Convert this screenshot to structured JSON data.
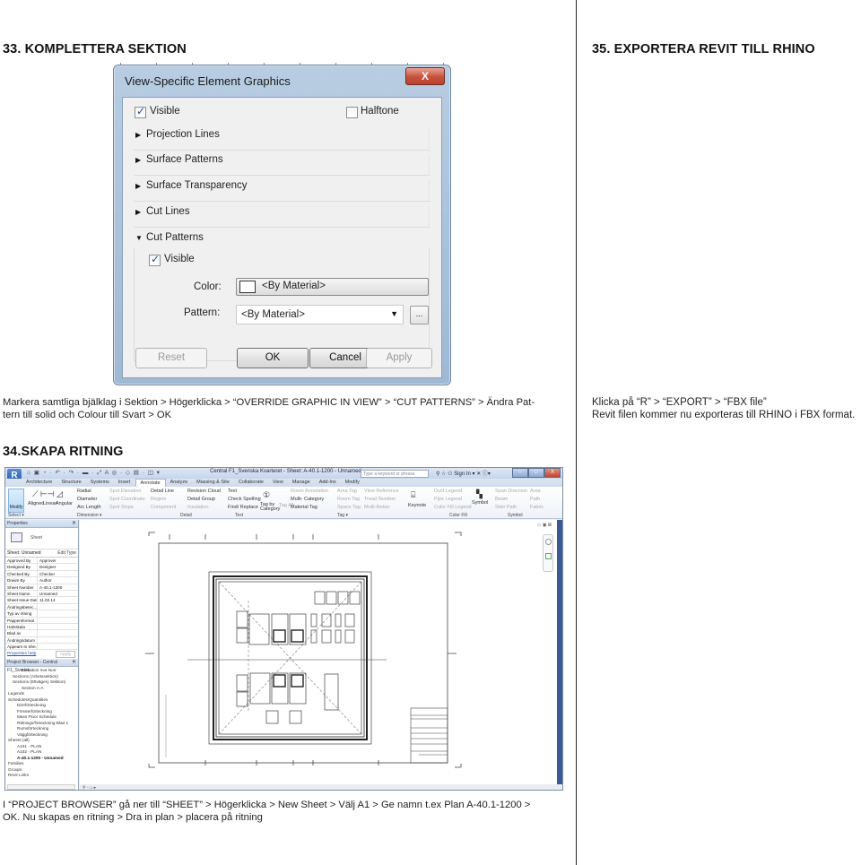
{
  "sections": {
    "s33": {
      "title": "33. KOMPLETTERA SEKTION",
      "caption_line1": "Markera samtliga bjälklag i Sektion > Högerklicka > “OVERRIDE GRAPHIC IN VIEW” > “CUT PATTERNS” > Ändra Pat-",
      "caption_line2": "tern till solid och Colour till Svart > OK"
    },
    "s34": {
      "title": "34.SKAPA RITNING",
      "caption_line1": "I “PROJECT BROWSER” gå ner till “SHEET” > Högerklicka > New Sheet > Välj A1 > Ge namn t.ex Plan A-40.1-1200 >",
      "caption_line2": "OK. Nu skapas en ritning > Dra in plan > placera på ritning"
    },
    "s35": {
      "title": "35. EXPORTERA REVIT TILL RHINO",
      "caption_line1": "Klicka på “R” > “EXPORT” > “FBX file”",
      "caption_line2": "Revit filen kommer nu exporteras till RHINO i FBX format."
    }
  },
  "dialog": {
    "title": "View-Specific Element Graphics",
    "close_glyph": "X",
    "visible_label": "Visible",
    "visible_checked": true,
    "halftone_label": "Halftone",
    "halftone_checked": false,
    "groups": [
      {
        "label": "Projection Lines",
        "expanded": false
      },
      {
        "label": "Surface Patterns",
        "expanded": false
      },
      {
        "label": "Surface Transparency",
        "expanded": false
      },
      {
        "label": "Cut Lines",
        "expanded": false
      },
      {
        "label": "Cut Patterns",
        "expanded": true
      }
    ],
    "cut_patterns": {
      "visible_label": "Visible",
      "visible_checked": true,
      "color_label": "Color:",
      "color_value": "<By Material>",
      "pattern_label": "Pattern:",
      "pattern_value": "<By Material>",
      "ellipsis": "..."
    },
    "buttons": {
      "reset": "Reset",
      "ok": "OK",
      "cancel": "Cancel",
      "apply": "Apply"
    }
  },
  "revit": {
    "app_button": "R",
    "doc_title": "Central F1_Svenska Kvarteret - Sheet: A-40.1-1200 - Unnamed",
    "search_placeholder": "Type a keyword or phrase",
    "sign_in": "Sign In",
    "win_buttons": [
      "–",
      "□",
      "X"
    ],
    "tabs": [
      "Architecture",
      "Structure",
      "Systems",
      "Insert",
      "Annotate",
      "Analyze",
      "Massing & Site",
      "Collaborate",
      "View",
      "Manage",
      "Add-Ins",
      "Modify"
    ],
    "active_tab": "Annotate",
    "ribbon": {
      "modify": "Modify",
      "dimension_tools": [
        "Aligned",
        "Linear",
        "Angular"
      ],
      "dimension_small": [
        "Radial",
        "Diameter",
        "Arc Length"
      ],
      "spot_tools": [
        "Spot Elevation",
        "Spot Coordinate",
        "Spot Slope"
      ],
      "detail_tools": [
        "Detail Line",
        "Region",
        "Component"
      ],
      "detail_tools2": [
        "Revision Cloud",
        "Detail Group",
        "Insulation"
      ],
      "text_tools": [
        "Text",
        "Check Spelling",
        "Find/ Replace"
      ],
      "tag_tools": [
        "Tag by Category",
        "Tag All"
      ],
      "tag_tools2": [
        "Room Annotation",
        "Multi- Category",
        "Material Tag"
      ],
      "tag_tools3": [
        "Area Tag",
        "Room Tag",
        "Space Tag"
      ],
      "tag_tools4": [
        "View Reference",
        "Tread Number",
        "Multi-Rebar"
      ],
      "keynote": "Keynote",
      "colorfill_tools": [
        "Duct Legend",
        "Pipe Legend",
        "Color Fill Legend"
      ],
      "symbol": "Symbol",
      "symbol_tools": [
        "Span Direction",
        "Beam",
        "Stair Path"
      ],
      "symbol_tools2": [
        "Area",
        "Path",
        "Fabric"
      ],
      "panels": [
        "Select ▾",
        "Dimension ▾",
        "Detail",
        "Text",
        "Tag ▾",
        "Color Fill",
        "Symbol"
      ]
    },
    "properties": {
      "title": "Properties",
      "type_name": "Sheet",
      "instance": "Sheet: Unnamed",
      "edit_type": "Edit Type",
      "rows": [
        {
          "k": "Approved By",
          "v": "Approver"
        },
        {
          "k": "Designed By",
          "v": "Designer"
        },
        {
          "k": "Checked By",
          "v": "Checker"
        },
        {
          "k": "Drawn By",
          "v": "Author"
        },
        {
          "k": "Sheet Number",
          "v": "A-40.1-1200"
        },
        {
          "k": "Sheet Name",
          "v": "Unnamed"
        },
        {
          "k": "Sheet Issue Date",
          "v": "11.02.14"
        },
        {
          "k": "Ändringsbetec...",
          "v": ""
        },
        {
          "k": "Typ av ritning",
          "v": ""
        },
        {
          "k": "Pappersformat",
          "v": ""
        },
        {
          "k": "Halvskala",
          "v": ""
        },
        {
          "k": "Blad av",
          "v": ""
        },
        {
          "k": "Ändringsdatum",
          "v": ""
        },
        {
          "k": "Appears In She...",
          "v": ""
        }
      ],
      "help": "Properties help",
      "apply": "Apply"
    },
    "project_browser": {
      "title": "Project Browser - Central F1_Svensk...",
      "items": [
        {
          "label": "Elevation mot Norr",
          "indent": 3,
          "bold": false
        },
        {
          "label": "Sections (Arbetssektion)",
          "indent": 1,
          "bold": false
        },
        {
          "label": "Sections (Ettvägery Sektion)",
          "indent": 1,
          "bold": false
        },
        {
          "label": "Section A-A",
          "indent": 3,
          "bold": false
        },
        {
          "label": "Legends",
          "indent": 0,
          "bold": false
        },
        {
          "label": "Schedules/Quantities",
          "indent": 0,
          "bold": false
        },
        {
          "label": "Dörrförteckning",
          "indent": 2,
          "bold": false
        },
        {
          "label": "Fönsterförteckning",
          "indent": 2,
          "bold": false
        },
        {
          "label": "Mass Floor Schedule",
          "indent": 2,
          "bold": false
        },
        {
          "label": "Rälnings/förteckning Blad 1",
          "indent": 2,
          "bold": false
        },
        {
          "label": "Rumsförteckning",
          "indent": 2,
          "bold": false
        },
        {
          "label": "Väggförteckning",
          "indent": 2,
          "bold": false
        },
        {
          "label": "Sheets (all)",
          "indent": 0,
          "bold": false
        },
        {
          "label": "A101 - PLAN",
          "indent": 2,
          "bold": false
        },
        {
          "label": "A102 - PLAN",
          "indent": 2,
          "bold": false
        },
        {
          "label": "A-40.1-1200 - Unnamed",
          "indent": 2,
          "bold": true
        },
        {
          "label": "Families",
          "indent": 0,
          "bold": false
        },
        {
          "label": "Groups",
          "indent": 0,
          "bold": false
        },
        {
          "label": "Revit Links",
          "indent": 0,
          "bold": false
        }
      ]
    },
    "status_icons": "⚲ ◦ ⌂ ▸"
  }
}
